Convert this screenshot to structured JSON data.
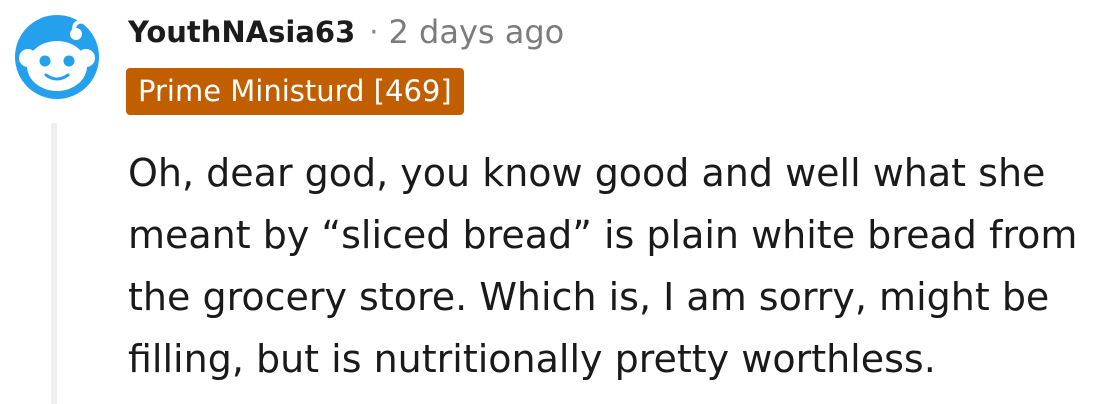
{
  "comment": {
    "avatar_icon": "reddit-snoo-avatar-icon",
    "username": "YouthNAsia63",
    "separator": "·",
    "timestamp": "2 days ago",
    "flair": "Prime Ministurd [469]",
    "body": "Oh, dear god, you know good and well what she meant by “sliced bread” is plain white bread from the grocery store. Which is, I am sorry, might be filling, but is nutritionally pretty worthless."
  },
  "colors": {
    "avatar_bg": "#24a0ed",
    "flair_bg": "#c15e00",
    "thread_line": "#edeff1",
    "timestamp": "#7c7c7c"
  }
}
